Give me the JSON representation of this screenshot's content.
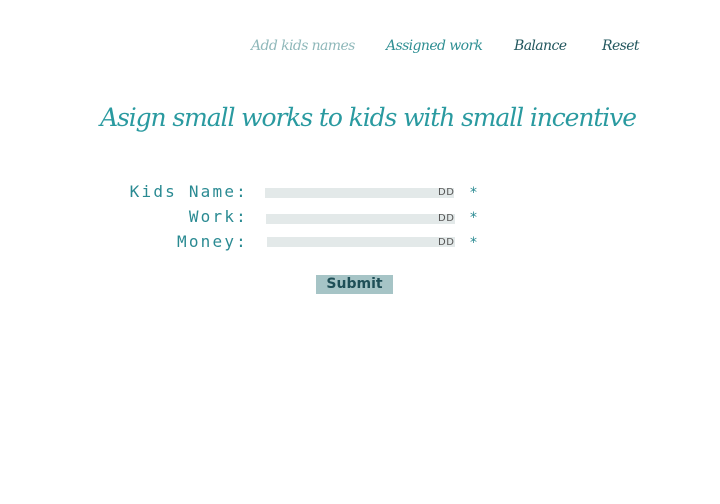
{
  "nav": {
    "add_kids_names": "Add kids names",
    "assigned_work": "Assigned work",
    "balance": "Balance",
    "reset": "Reset"
  },
  "headline": "Asign small works to kids with small incentive",
  "form": {
    "fields": [
      {
        "label": "Kids Name:",
        "autofill_hint": "DD",
        "required_mark": "*"
      },
      {
        "label": "Work:",
        "autofill_hint": "DD",
        "required_mark": "*"
      },
      {
        "label": "Money:",
        "autofill_hint": "DD",
        "required_mark": "*"
      }
    ],
    "submit_label": "Submit"
  },
  "colors": {
    "nav_inactive": "#8fb8ba",
    "nav_active": "#2f8f93",
    "nav_dark": "#22575e",
    "accent": "#2a9aa0",
    "field_bg": "#e3e9e9",
    "button_bg": "#a6c4c6"
  }
}
